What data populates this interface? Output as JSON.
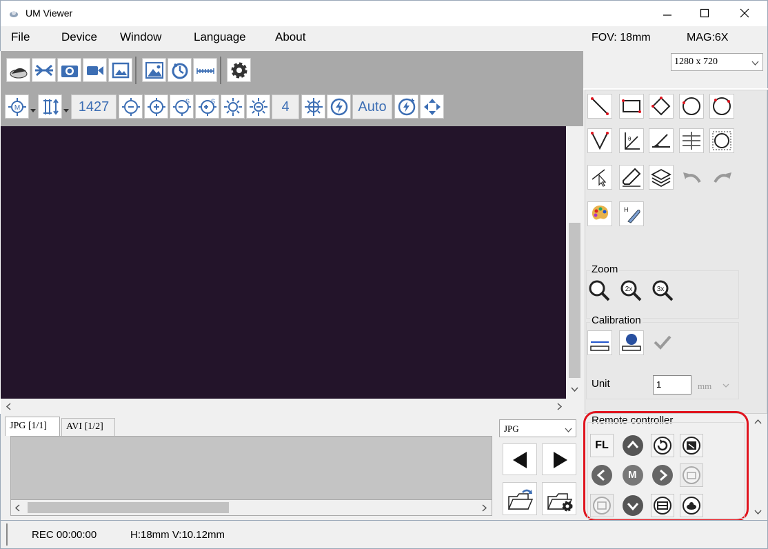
{
  "window": {
    "title": "UM Viewer"
  },
  "menu": {
    "items": [
      "File",
      "Device",
      "Window",
      "Language",
      "About"
    ],
    "fov": "FOV: 18mm",
    "mag": "MAG:6X"
  },
  "resolution": {
    "selected": "1280 x 720"
  },
  "toolbar2": {
    "focus_value": "1427",
    "step_value": "4",
    "exposure_value": "Auto"
  },
  "right_panel": {
    "zoom_label": "Zoom",
    "calibration_label": "Calibration",
    "unit_label": "Unit",
    "unit_value": "1",
    "unit_select": "mm",
    "remote_label": "Remote controller",
    "remote_fl": "FL",
    "remote_m": "M"
  },
  "files": {
    "tabs": [
      "JPG [1/1]",
      "AVI [1/2]"
    ],
    "format": "JPG"
  },
  "status": {
    "rec": "REC 00:00:00",
    "size": "H:18mm V:10.12mm"
  },
  "colors": {
    "accent": "#3c6eb4",
    "highlight": "#e0141e",
    "viewport": "#23142a",
    "toolbar": "#a9a9a9"
  }
}
